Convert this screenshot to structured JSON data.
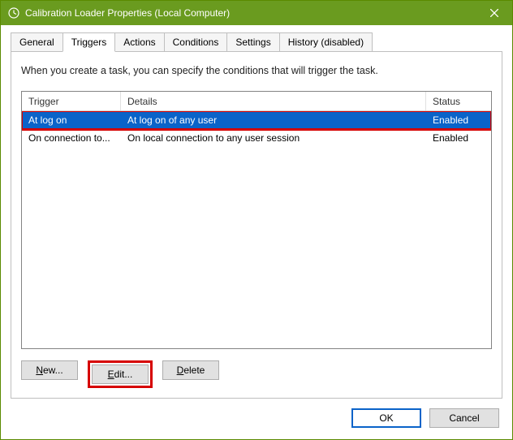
{
  "window": {
    "title": "Calibration Loader Properties (Local Computer)"
  },
  "tabs": {
    "general": "General",
    "triggers": "Triggers",
    "actions": "Actions",
    "conditions": "Conditions",
    "settings": "Settings",
    "history": "History (disabled)"
  },
  "hint": "When you create a task, you can specify the conditions that will trigger the task.",
  "columns": {
    "trigger": "Trigger",
    "details": "Details",
    "status": "Status"
  },
  "rows": [
    {
      "trigger": "At log on",
      "details": "At log on of any user",
      "status": "Enabled",
      "selected": true
    },
    {
      "trigger": "On connection to...",
      "details": "On local connection to any user session",
      "status": "Enabled",
      "selected": false
    }
  ],
  "buttons": {
    "new_prefix": "N",
    "new_rest": "ew...",
    "edit_prefix": "E",
    "edit_rest": "dit...",
    "delete_prefix": "D",
    "delete_rest": "elete",
    "ok": "OK",
    "cancel": "Cancel"
  }
}
